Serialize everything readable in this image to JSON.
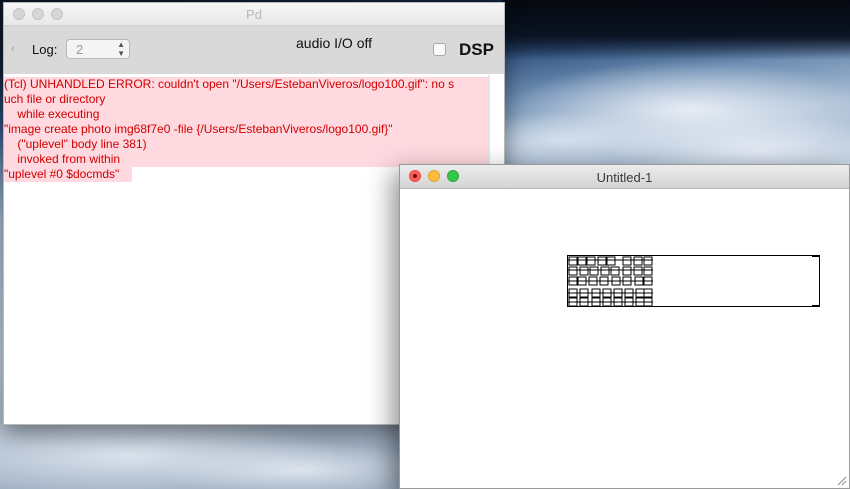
{
  "pd_window": {
    "title": "Pd",
    "toolbar": {
      "log_label": "Log:",
      "log_value": "2",
      "audio_status": "audio I/O off",
      "dsp_label": "DSP",
      "dsp_checked": false
    },
    "console_lines": [
      "(Tcl) UNHANDLED ERROR: couldn't open \"/Users/EstebanViveros/logo100.gif\": no s",
      "uch file or directory",
      "    while executing",
      "\"image create photo img68f7e0 -file {/Users/EstebanViveros/logo100.gif}\"",
      "    (\"uplevel\" body line 381)",
      "    invoked from within",
      "\"uplevel #0 $docmds\""
    ],
    "error_color": "#d10000",
    "error_bg": "#ffd9e0"
  },
  "patch_window": {
    "title": "Untitled-1"
  },
  "icons": [
    "traffic-light-close",
    "traffic-light-minimize",
    "traffic-light-zoom",
    "chevron-left",
    "select-arrows",
    "resize-grip"
  ]
}
